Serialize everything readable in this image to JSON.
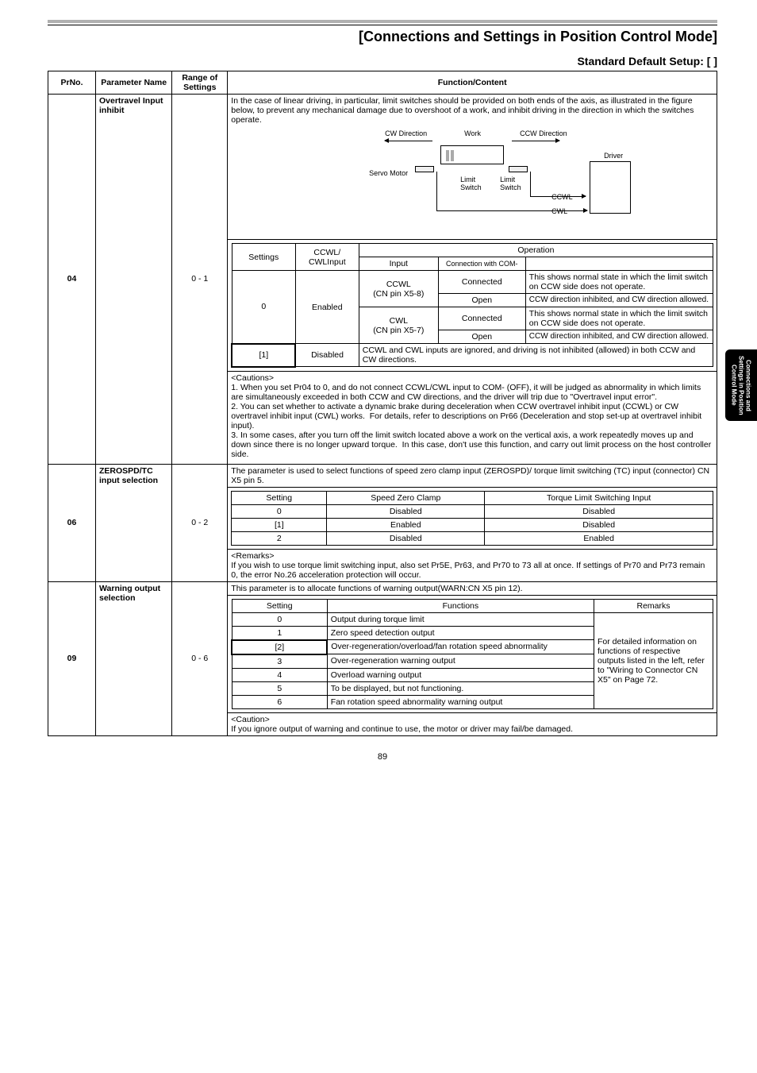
{
  "page_number": "89",
  "doc_title": "[Connections and Settings in Position Control Mode]",
  "setup_title": "Standard Default Setup: [  ]",
  "side_tab": "Connections and\nSettings in Position\nControl Mode",
  "headers": {
    "prno": "PrNo.",
    "param_name": "Parameter Name",
    "range": "Range of Settings",
    "func": "Function/Content"
  },
  "row04": {
    "prno": "04",
    "name": "Overtravel Input inhibit",
    "range": "0 - 1",
    "desc_top": "In the case of linear driving, in particular, limit switches should be provided on both ends of the axis, as illustrated in the figure below, to prevent any mechanical damage due to overshoot of a work, and inhibit driving in the direction in which the switches operate.",
    "diagram": {
      "cw_dir": "CW Direction",
      "work": "Work",
      "ccw_dir": "CCW Direction",
      "servo_motor": "Servo Motor",
      "limit": "Limit",
      "switch": "Switch",
      "ccwl": "CCWL",
      "cwl": "CWL",
      "driver": "Driver"
    },
    "t1": {
      "settings": "Settings",
      "ccwl": "CCWL/ CWLInput",
      "input": "Input",
      "conn_com": "Connection with COM-",
      "operation": "Operation",
      "zero": "0",
      "enabled": "Enabled",
      "ccwl_pin": "CCWL",
      "ccwl_pin2": "(CN pin X5-8)",
      "cwl_pin": "CWL",
      "cwl_pin2": "(CN pin X5-7)",
      "connected": "Connected",
      "open": "Open",
      "op1": "This shows normal state in which the limit switch on CCW side does not operate.",
      "op2": "CCW direction inhibited, and CW direction allowed.",
      "op3": "This shows normal state in which the limit switch on CCW side does not operate.",
      "op4": "CCW direction inhibited, and CW direction allowed.",
      "one": "[1]",
      "disabled": "Disabled",
      "op5": "CCWL and CWL inputs are ignored, and driving is not inhibited (allowed) in both CCW and CW directions."
    },
    "cautions_title": "<Cautions>",
    "cautions": "1. When you set Pr04 to 0, and do not connect CCWL/CWL input to COM- (OFF), it will be judged as abnormality in which limits are simultaneously exceeded in both CCW and CW directions, and the driver will trip due to \"Overtravel input error\".\n2. You can set whether to activate a dynamic brake during deceleration when CCW overtravel inhibit input (CCWL) or CW overtravel inhibit input (CWL) works.  For details, refer to descriptions on Pr66 (Deceleration and stop set-up at overtravel inhibit input).\n3. In some cases, after you turn off the limit switch located above a work on the vertical axis, a work repeatedly moves up and down since there is no longer upward torque.  In this case, don't use this function, and carry out limit process on the host controller side."
  },
  "row06": {
    "prno": "06",
    "name": "ZEROSPD/TC input selection",
    "range": "0 - 2",
    "desc": "The parameter is used to select functions of speed zero clamp input (ZEROSPD)/ torque limit switching (TC) input (connector) CN X5 pin 5.",
    "t": {
      "setting": "Setting",
      "sz": "Speed Zero Clamp",
      "tl": "Torque Limit Switching Input",
      "r0": "0",
      "r0a": "Disabled",
      "r0b": "Disabled",
      "r1": "[1]",
      "r1a": "Enabled",
      "r1b": "Disabled",
      "r2": "2",
      "r2a": "Disabled",
      "r2b": "Enabled"
    },
    "remarks_title": "<Remarks>",
    "remarks": "If you wish to use torque limit switching input, also set Pr5E, Pr63, and Pr70 to 73 all at once.  If settings of Pr70 and Pr73 remain 0, the error No.26 acceleration protection will occur."
  },
  "row09": {
    "prno": "09",
    "name": "Warning output selection",
    "range": "0 - 6",
    "desc": "This parameter is to allocate functions of warning output(WARN:CN X5 pin 12).",
    "t": {
      "setting": "Setting",
      "func": "Functions",
      "remarks": "Remarks",
      "r0": "0",
      "f0": "Output during torque limit",
      "r1": "1",
      "f1": "Zero speed detection output",
      "r2": "[2]",
      "f2": "Over-regeneration/overload/fan rotation speed abnormality",
      "r3": "3",
      "f3": "Over-regeneration warning output",
      "r4": "4",
      "f4": "Overload warning output",
      "r5": "5",
      "f5": "To be displayed, but not functioning.",
      "r6": "6",
      "f6": "Fan rotation speed abnormality warning output",
      "remarks_text": "For detailed information on functions of respective outputs listed in the left, refer to \"Wiring to Connector CN X5\" on Page 72."
    },
    "caution_title": "<Caution>",
    "caution": "If you ignore output of warning and continue to use, the motor or driver may fail/be damaged."
  }
}
